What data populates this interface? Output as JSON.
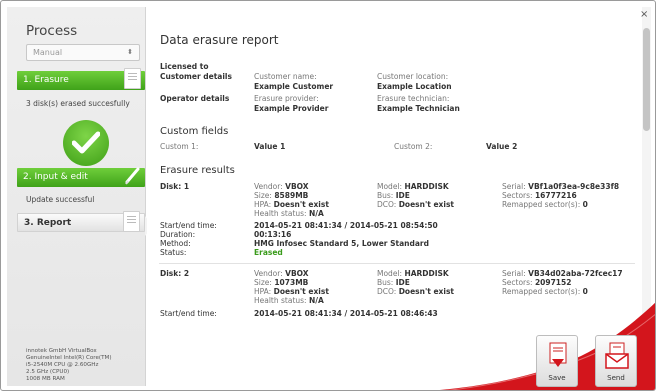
{
  "sidebar": {
    "title": "Process",
    "select_value": "Manual",
    "steps": [
      {
        "label": "1. Erasure",
        "note": "3 disk(s) erased succesfully"
      },
      {
        "label": "2. Input & edit",
        "note": "Update successful"
      },
      {
        "label": "3. Report"
      }
    ],
    "sysinfo": [
      "innotek GmbH VirtualBox",
      "GenuineIntel Intel(R) Core(TM)",
      "i5-2540M CPU @ 2.60GHz",
      "2.5 GHz (CPU0)",
      "1008 MB RAM"
    ]
  },
  "report": {
    "title": "Data erasure report",
    "licensed_label": "Licensed to",
    "customer_details_label": "Customer details",
    "operator_details_label": "Operator details",
    "customer_name_label": "Customer name:",
    "customer_name": "Example Customer",
    "customer_location_label": "Customer location:",
    "customer_location": "Example Location",
    "erasure_provider_label": "Erasure provider:",
    "erasure_provider": "Example Provider",
    "erasure_technician_label": "Erasure technician:",
    "erasure_technician": "Example Technician",
    "custom_fields_title": "Custom fields",
    "custom1_label": "Custom 1:",
    "custom1_value": "Value 1",
    "custom2_label": "Custom 2:",
    "custom2_value": "Value 2",
    "erasure_results_title": "Erasure results",
    "disks": [
      {
        "label": "Disk: 1",
        "vendor_label": "Vendor:",
        "vendor": "VBOX",
        "size_label": "Size:",
        "size": "8589MB",
        "hpa_label": "HPA:",
        "hpa": "Doesn't exist",
        "health_label": "Health status:",
        "health": "N/A",
        "model_label": "Model:",
        "model": "HARDDISK",
        "bus_label": "Bus:",
        "bus": "IDE",
        "dco_label": "DCO:",
        "dco": "Doesn't exist",
        "serial_label": "Serial:",
        "serial": "VBf1a0f3ea-9c8e33f8",
        "sectors_label": "Sectors:",
        "sectors": "16777216",
        "remapped_label": "Remapped sector(s):",
        "remapped": "0",
        "startend_label": "Start/end time:",
        "startend": "2014-05-21 08:41:34 / 2014-05-21 08:54:50",
        "duration_label": "Duration:",
        "duration": "00:13:16",
        "method_label": "Method:",
        "method": "HMG Infosec Standard 5, Lower Standard",
        "status_label": "Status:",
        "status": "Erased"
      },
      {
        "label": "Disk: 2",
        "vendor_label": "Vendor:",
        "vendor": "VBOX",
        "size_label": "Size:",
        "size": "1073MB",
        "hpa_label": "HPA:",
        "hpa": "Doesn't exist",
        "health_label": "Health status:",
        "health": "N/A",
        "model_label": "Model:",
        "model": "HARDDISK",
        "bus_label": "Bus:",
        "bus": "IDE",
        "dco_label": "DCO:",
        "dco": "Doesn't exist",
        "serial_label": "Serial:",
        "serial": "VB34d02aba-72fcec17",
        "sectors_label": "Sectors:",
        "sectors": "2097152",
        "remapped_label": "Remapped sector(s):",
        "remapped": "0",
        "startend_label": "Start/end time:",
        "startend": "2014-05-21 08:41:34 / 2014-05-21 08:46:43"
      }
    ]
  },
  "actions": {
    "save_label": "Save",
    "send_label": "Send"
  },
  "window": {
    "close_glyph": "×"
  },
  "colors": {
    "green_accent": "#4fb625",
    "red_accent": "#d3151c",
    "erased_status": "#3a9b1b"
  }
}
